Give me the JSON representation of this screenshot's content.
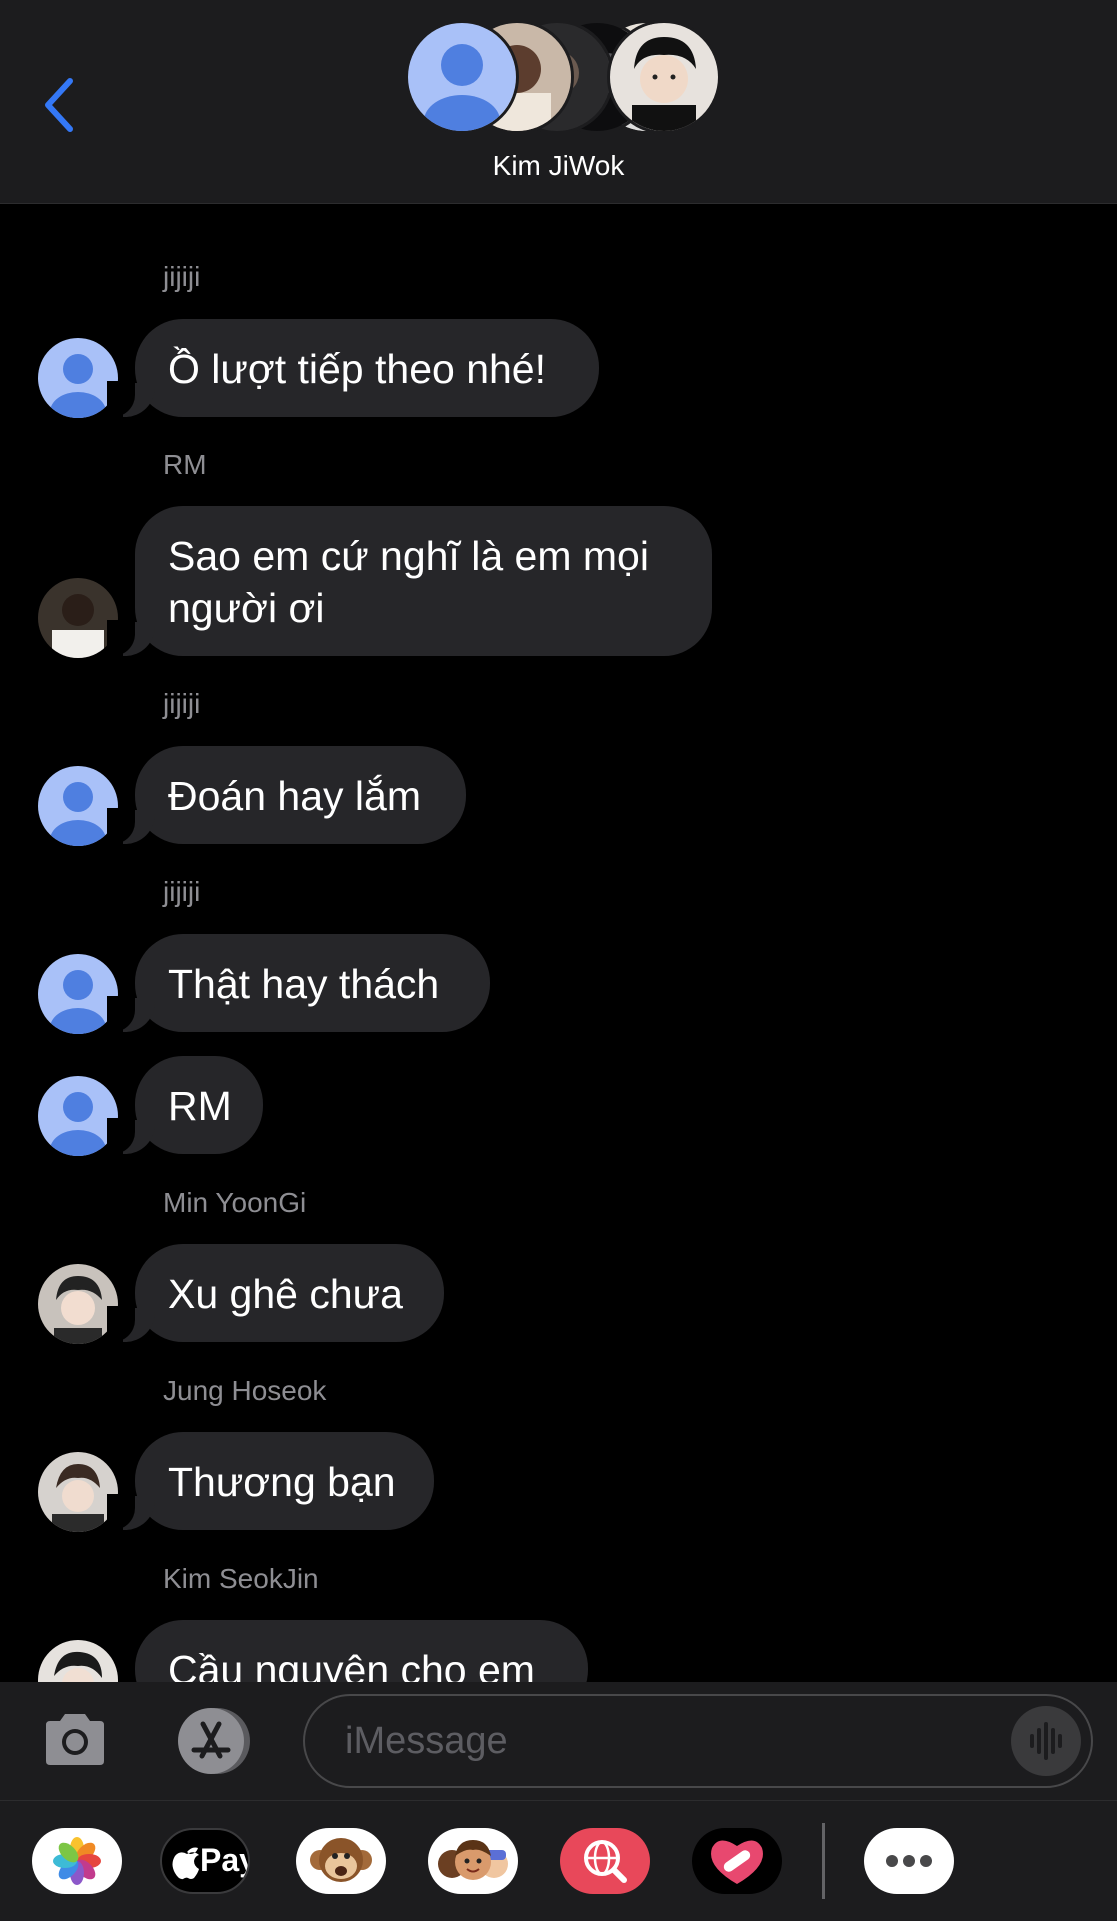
{
  "header": {
    "contact_name": "Kim JiWok"
  },
  "messages": [
    {
      "sender": "jijiji",
      "text": "Ồ lượt tiếp theo nhé!"
    },
    {
      "sender": "RM",
      "text": "Sao em cứ nghĩ là em mọi người ơi"
    },
    {
      "sender": "jijiji",
      "text": "Đoán hay lắm"
    },
    {
      "sender": "jijiji",
      "text": "Thật hay thách"
    },
    {
      "sender": "",
      "text": "RM"
    },
    {
      "sender": "Min YoonGi",
      "text": "Xu ghê chưa"
    },
    {
      "sender": "Jung Hoseok",
      "text": "Thương bạn"
    },
    {
      "sender": "Kim SeokJin",
      "text": "Cầu nguyên cho em"
    }
  ],
  "compose": {
    "placeholder": "iMessage"
  },
  "drawer": {
    "apple_pay_label": "Pay"
  },
  "colors": {
    "accent": "#3478f6",
    "bubble": "#262629",
    "header_bg": "#1c1c1e",
    "avatar_placeholder": "#a9c1f8"
  },
  "icons": [
    "back-chevron-icon",
    "camera-icon",
    "app-store-icon",
    "audio-waveform-icon",
    "photos-icon",
    "apple-icon",
    "animoji-monkey-icon",
    "memoji-icon",
    "globe-search-icon",
    "digital-touch-icon",
    "more-icon"
  ]
}
